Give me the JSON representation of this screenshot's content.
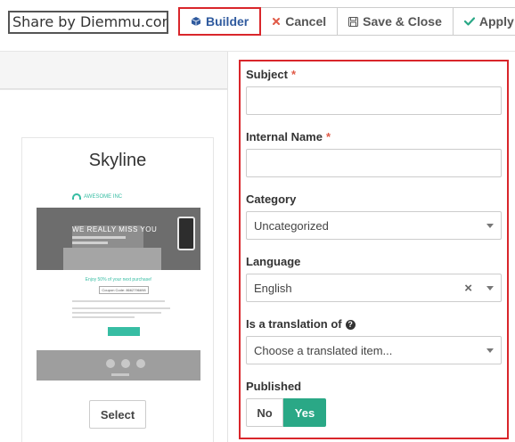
{
  "watermark": "Share by Diemmu.com",
  "toolbar": {
    "builder": "Builder",
    "cancel": "Cancel",
    "save_close": "Save & Close",
    "apply": "Apply"
  },
  "template": {
    "name": "Skyline",
    "select_label": "Select",
    "preview": {
      "brand": "AWESOME INC",
      "hero_text": "WE REALLY MISS YOU",
      "offer": "Enjoy 50% of your next purchase!",
      "coupon": "Coupon Code: 8662796698"
    }
  },
  "form": {
    "subject": {
      "label": "Subject",
      "required_mark": "*",
      "value": ""
    },
    "internal_name": {
      "label": "Internal Name",
      "required_mark": "*",
      "value": ""
    },
    "category": {
      "label": "Category",
      "value": "Uncategorized"
    },
    "language": {
      "label": "Language",
      "value": "English",
      "clear": "×"
    },
    "translation": {
      "label": "Is a translation of",
      "help": "?",
      "placeholder": "Choose a translated item..."
    },
    "published": {
      "label": "Published",
      "no": "No",
      "yes": "Yes",
      "selected": "Yes"
    }
  },
  "colors": {
    "accent_green": "#2aa886",
    "highlight_red": "#d9262b",
    "builder_blue": "#2f5a9e",
    "required_red": "#e05a47"
  },
  "icons": {
    "builder": "cube-icon",
    "cancel": "close-icon",
    "save_close": "save-icon",
    "apply": "check-icon"
  }
}
